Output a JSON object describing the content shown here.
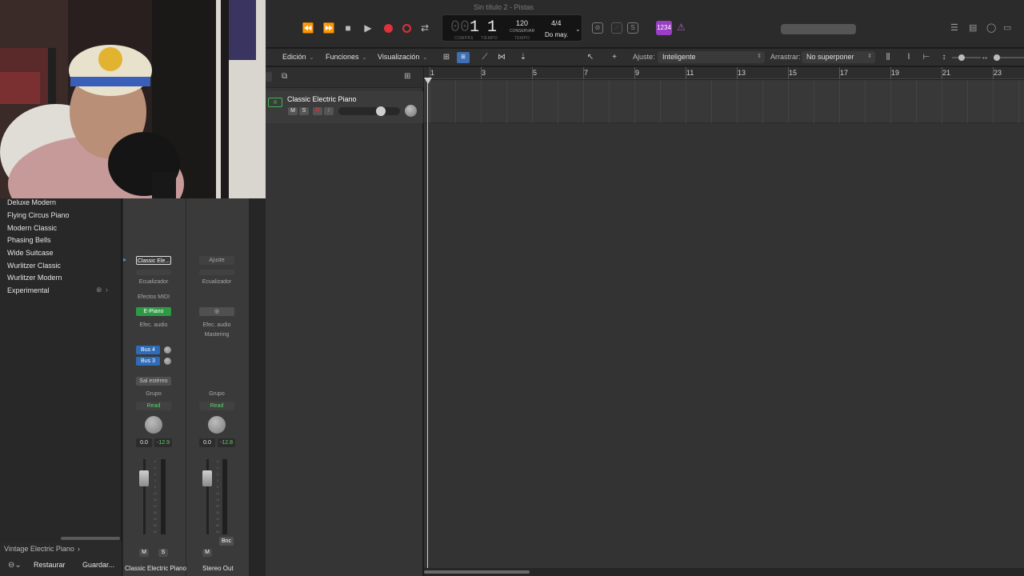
{
  "window": {
    "title": "Sin título 2 - Pistas"
  },
  "transport": {
    "lcd": {
      "bar_dim": "00",
      "bar": "1",
      "beat": "1",
      "bar_label": "COMPÁS",
      "beat_label": "TIEMPO",
      "tempo": "120",
      "tempo_mode": "CONSERVAR",
      "tempo_label": "TEMPO",
      "signature": "4/4",
      "key": "Do may."
    },
    "count_in": "1234"
  },
  "toolbar": {
    "edit": "Edición",
    "functions": "Funciones",
    "view": "Visualización",
    "snap_label": "Ajuste:",
    "snap_value": "Inteligente",
    "drag_label": "Arrastrar:",
    "drag_value": "No superponer"
  },
  "library": {
    "items": [
      "Deluxe Modern",
      "Flying Circus Piano",
      "Modern Classic",
      "Phasing Bells",
      "Wide Suitcase",
      "Wurlitzer Classic",
      "Wurlitzer Modern",
      "Experimental"
    ],
    "path": "Vintage Electric Piano",
    "restore": "Restaurar",
    "save": "Guardar..."
  },
  "mixer": {
    "strip1": {
      "setting": "Classic Ele...",
      "eq": "Ecualizador",
      "midi_fx": "Efectos MIDI",
      "instrument": "E-Piano",
      "audio_fx": "Efec. audio",
      "sends": [
        "Bus 4",
        "Bus 3"
      ],
      "output": "Sal estéreo",
      "group": "Grupo",
      "automation": "Read",
      "volume": "0.0",
      "peak": "-12.9",
      "mute": "M",
      "solo": "S",
      "name": "Classic Electric Piano"
    },
    "strip2": {
      "setting": "Ajuste",
      "eq": "Ecualizador",
      "audio_fx": "Efec. audio",
      "audio_fx_slot": "Mastering",
      "group": "Grupo",
      "automation": "Read",
      "volume": "0.0",
      "peak": "-12.8",
      "bounce": "Bnc",
      "mute": "M",
      "name": "Stereo Out"
    },
    "fader_scale": [
      "6",
      "3",
      "0",
      "3",
      "6",
      "10",
      "15",
      "20",
      "30",
      "40",
      "50",
      "60"
    ]
  },
  "track": {
    "name": "Classic Electric Piano",
    "mute": "M",
    "solo": "S",
    "record": "R",
    "input": "I",
    "volume_level": 0.72
  },
  "ruler": {
    "bars": [
      "1",
      "3",
      "5",
      "7",
      "9",
      "11",
      "13",
      "15",
      "17",
      "19",
      "21",
      "23"
    ]
  },
  "colors": {
    "record": "#e0303a",
    "count_in": "#9a3fc4",
    "instrument_slot": "#2f9a45",
    "send_slot": "#2e6bb8",
    "read": "#5ad36c"
  }
}
